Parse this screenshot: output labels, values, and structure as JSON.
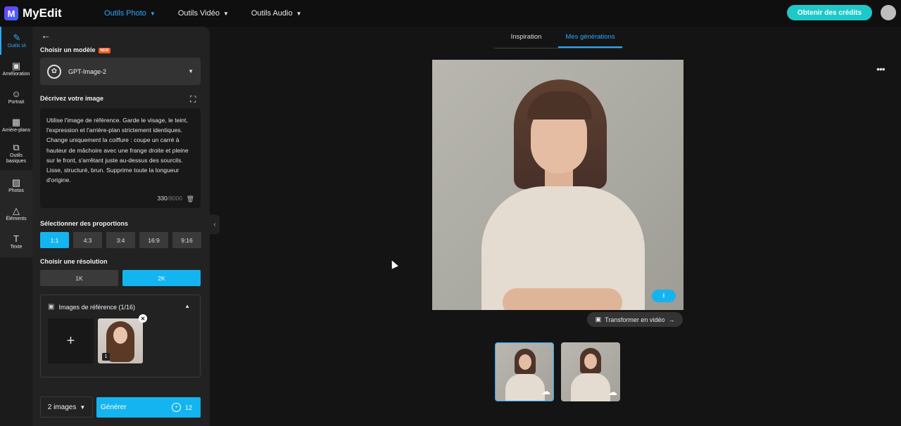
{
  "app": {
    "logo_letter": "M",
    "name": "MyEdit"
  },
  "topnav": [
    {
      "label": "Outils Photo",
      "active": true
    },
    {
      "label": "Outils Vidéo",
      "active": false
    },
    {
      "label": "Outils Audio",
      "active": false
    }
  ],
  "header": {
    "credits_button": "Obtenir des crédits"
  },
  "rail": {
    "items": [
      {
        "label": "Outils IA",
        "icon": "magic-wand-icon",
        "active": true
      },
      {
        "label": "Amélioration",
        "icon": "image-enhance-icon"
      },
      {
        "label": "Portrait",
        "icon": "portrait-icon"
      },
      {
        "label": "Arrière-plans",
        "icon": "background-icon"
      },
      {
        "label": "Outils basiques",
        "icon": "crop-icon"
      }
    ],
    "group": [
      {
        "label": "Photos",
        "icon": "photo-icon"
      },
      {
        "label": "Éléments",
        "icon": "shapes-icon"
      },
      {
        "label": "Texte",
        "icon": "text-icon"
      }
    ]
  },
  "panel": {
    "model_title": "Choisir un modèle",
    "new_badge": "NEW",
    "model_name": "GPT-Image-2",
    "prompt_title": "Décrivez votre image",
    "prompt_text": "Utilise l'image de référence. Garde le visage, le teint, l'expression et l'arrière-plan strictement identiques. Change uniquement la coiffure : coupe un carré à hauteur de mâchoire avec une frange droite et pleine sur le front, s'arrêtant juste au-dessus des sourcils. Lisse, structuré, brun. Supprime toute la longueur d'origine.",
    "prompt_count": "330",
    "prompt_max": "/8000",
    "ratio_title": "Sélectionner des proportions",
    "ratios": [
      "1:1",
      "4:3",
      "3:4",
      "16:9",
      "9:16"
    ],
    "ratio_selected": "1:1",
    "resolution_title": "Choisir une résolution",
    "resolutions": [
      "1K",
      "2K"
    ],
    "resolution_selected": "2K",
    "reference_title": "Images de référence (1/16)",
    "reference_index": "1",
    "image_count": "2 images",
    "generate_label": "Générer",
    "generate_cost": "12"
  },
  "tabs": [
    {
      "label": "Inspiration",
      "active": false
    },
    {
      "label": "Mes générations",
      "active": true
    }
  ],
  "result": {
    "transform_video": "Transformer en vidéo"
  }
}
